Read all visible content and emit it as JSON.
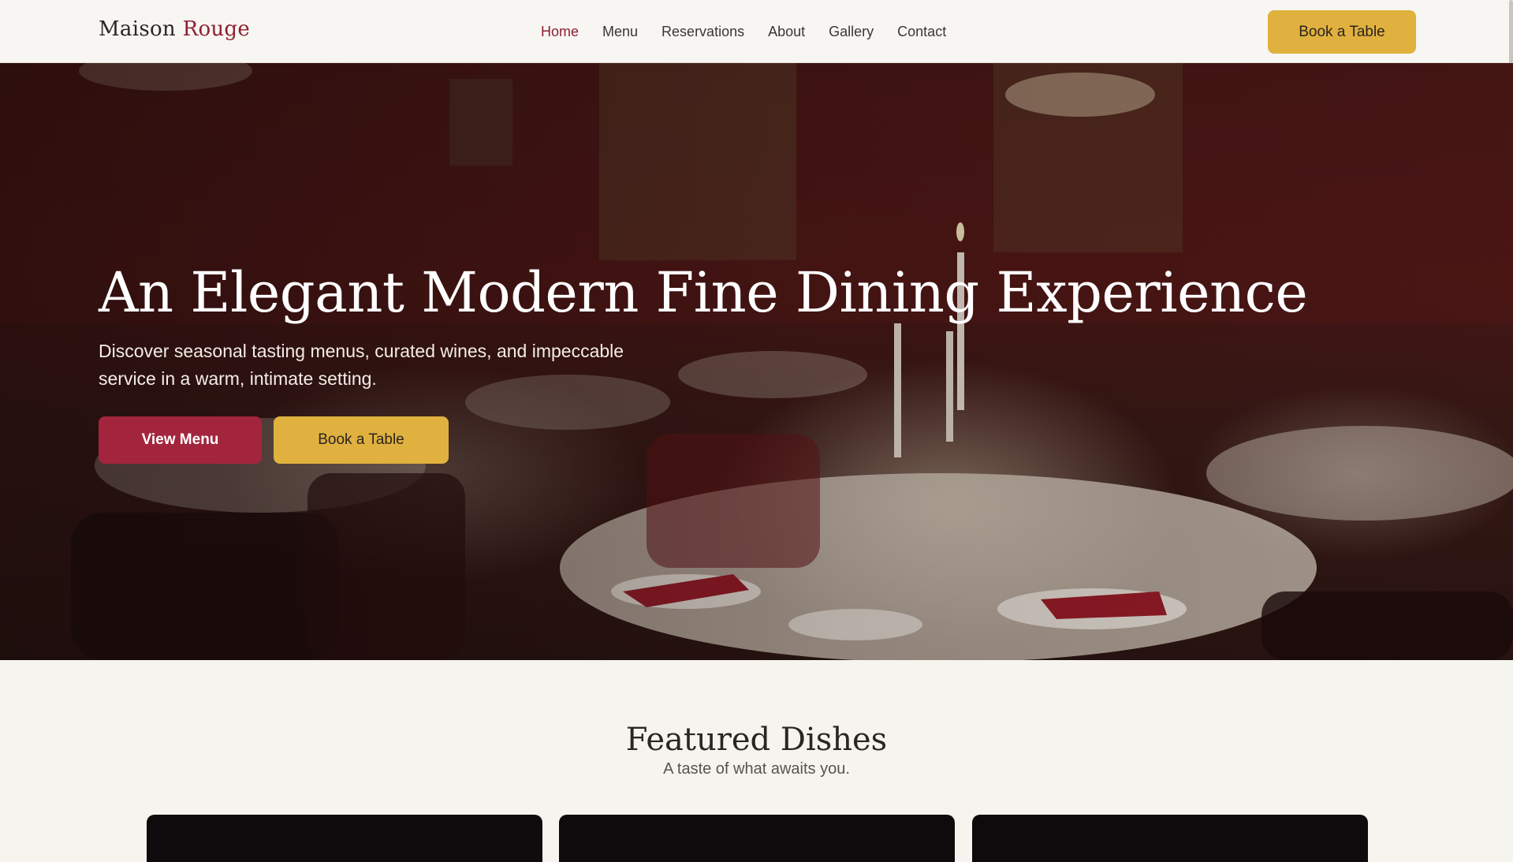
{
  "brand": {
    "name_part1": "Maison",
    "name_part2": "Rouge"
  },
  "nav": {
    "items": [
      {
        "label": "Home"
      },
      {
        "label": "Menu"
      },
      {
        "label": "Reservations"
      },
      {
        "label": "About"
      },
      {
        "label": "Gallery"
      },
      {
        "label": "Contact"
      }
    ],
    "cta_label": "Book a Table"
  },
  "hero": {
    "title": "An Elegant Modern Fine Dining Experience",
    "subtitle": "Discover seasonal tasting menus, curated wines, and impeccable service in a warm, intimate setting.",
    "primary_button": "View Menu",
    "secondary_button": "Book a Table"
  },
  "featured": {
    "title": "Featured Dishes",
    "subtitle": "A taste of what awaits you."
  },
  "colors": {
    "accent_red": "#a3253d",
    "accent_gold": "#e0b13e",
    "brand_red_text": "#8e1f31"
  }
}
